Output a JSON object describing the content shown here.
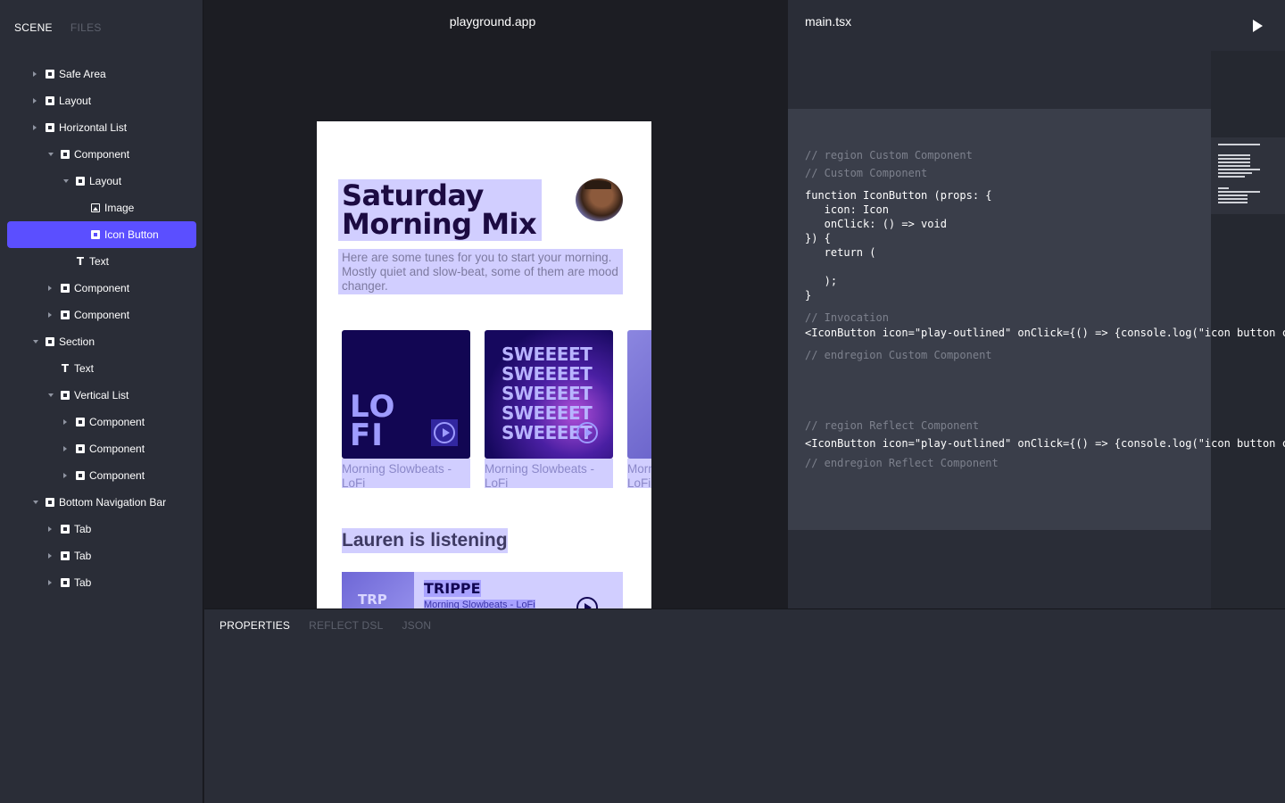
{
  "sidebar": {
    "tabs": [
      {
        "label": "SCENE",
        "active": true
      },
      {
        "label": "FILES",
        "active": false
      }
    ],
    "tree": [
      {
        "label": "Safe Area",
        "icon": "frame",
        "chevron": "right",
        "depth": 1
      },
      {
        "label": "Layout",
        "icon": "frame",
        "chevron": "right",
        "depth": 1
      },
      {
        "label": "Horizontal List",
        "icon": "frame",
        "chevron": "right",
        "depth": 1
      },
      {
        "label": "Component",
        "icon": "frame",
        "chevron": "down",
        "depth": 2
      },
      {
        "label": "Layout",
        "icon": "frame",
        "chevron": "down",
        "depth": 3
      },
      {
        "label": "Image",
        "icon": "image",
        "chevron": "none",
        "depth": 4
      },
      {
        "label": "Icon Button",
        "icon": "frame",
        "chevron": "none",
        "depth": 4,
        "selected": true
      },
      {
        "label": "Text",
        "icon": "text",
        "chevron": "none",
        "depth": 3
      },
      {
        "label": "Component",
        "icon": "frame",
        "chevron": "right",
        "depth": 2
      },
      {
        "label": "Component",
        "icon": "frame",
        "chevron": "right",
        "depth": 2
      },
      {
        "label": "Section",
        "icon": "frame",
        "chevron": "down",
        "depth": 1
      },
      {
        "label": "Text",
        "icon": "text",
        "chevron": "none",
        "depth": 2
      },
      {
        "label": "Vertical List",
        "icon": "frame",
        "chevron": "down",
        "depth": 2
      },
      {
        "label": "Component",
        "icon": "frame",
        "chevron": "right",
        "depth": 3
      },
      {
        "label": "Component",
        "icon": "frame",
        "chevron": "right",
        "depth": 3
      },
      {
        "label": "Component",
        "icon": "frame",
        "chevron": "right",
        "depth": 3
      },
      {
        "label": "Bottom Navigation Bar",
        "icon": "frame",
        "chevron": "down",
        "depth": 1
      },
      {
        "label": "Tab",
        "icon": "frame",
        "chevron": "right",
        "depth": 2
      },
      {
        "label": "Tab",
        "icon": "frame",
        "chevron": "right",
        "depth": 2
      },
      {
        "label": "Tab",
        "icon": "frame",
        "chevron": "right",
        "depth": 2
      }
    ]
  },
  "canvas": {
    "title": "playground.app",
    "preview": {
      "headline_line1": "Saturday",
      "headline_line2": "Morning Mix",
      "blurb": "Here are some tunes for you to start your morning. Mostly quiet and slow-beat, some of them are mood changer.",
      "cards": [
        {
          "art_text": "LO\nFI",
          "caption": "Morning Slowbeats - LoFi"
        },
        {
          "art_text": "SWEEEET\nSWEEEET\nSWEEEET\nSWEEEET\nSWEEEET",
          "caption": "Morning Slowbeats - LoFi"
        },
        {
          "art_text": "",
          "caption": "Morning Slowbeats - LoFi"
        }
      ],
      "section_title": "Lauren is listening",
      "list_item": {
        "art_text": "TRP",
        "title": "TRIPPE",
        "subtitle": "Morning Slowbeats - LoFi"
      }
    }
  },
  "editor": {
    "filename": "main.tsx",
    "lines": [
      {
        "text": "// region Custom Component",
        "kind": "comment"
      },
      {
        "text": "// Custom Component",
        "kind": "comment"
      },
      {
        "text": "function IconButton (props: {",
        "kind": "code"
      },
      {
        "text": "   icon: Icon",
        "kind": "code"
      },
      {
        "text": "   onClick: () => void",
        "kind": "code"
      },
      {
        "text": "}) {",
        "kind": "code"
      },
      {
        "text": "   return (",
        "kind": "code"
      },
      {
        "text": "",
        "kind": "code"
      },
      {
        "text": "   );",
        "kind": "code"
      },
      {
        "text": "}",
        "kind": "code"
      },
      {
        "text": "// Invocation",
        "kind": "comment"
      },
      {
        "text": "<IconButton icon=\"play-outlined\" onClick={() => {console.log(\"icon button clicked\")}}/>",
        "kind": "code"
      },
      {
        "text": "// endregion Custom Component",
        "kind": "comment"
      },
      {
        "text": "// region Reflect Component",
        "kind": "comment"
      },
      {
        "text": "<IconButton icon=\"play-outlined\" onClick={() => {console.log(\"icon button clicked\")}}/>",
        "kind": "code"
      },
      {
        "text": "// endregion Reflect Component",
        "kind": "comment"
      }
    ]
  },
  "bottom_panel": {
    "tabs": [
      {
        "label": "PROPERTIES",
        "active": true
      },
      {
        "label": "REFLECT DSL",
        "active": false
      },
      {
        "label": "JSON",
        "active": false
      }
    ]
  },
  "colors": {
    "accent": "#5b4fff",
    "panel": "#2a2d37",
    "background": "#1c1d23"
  }
}
